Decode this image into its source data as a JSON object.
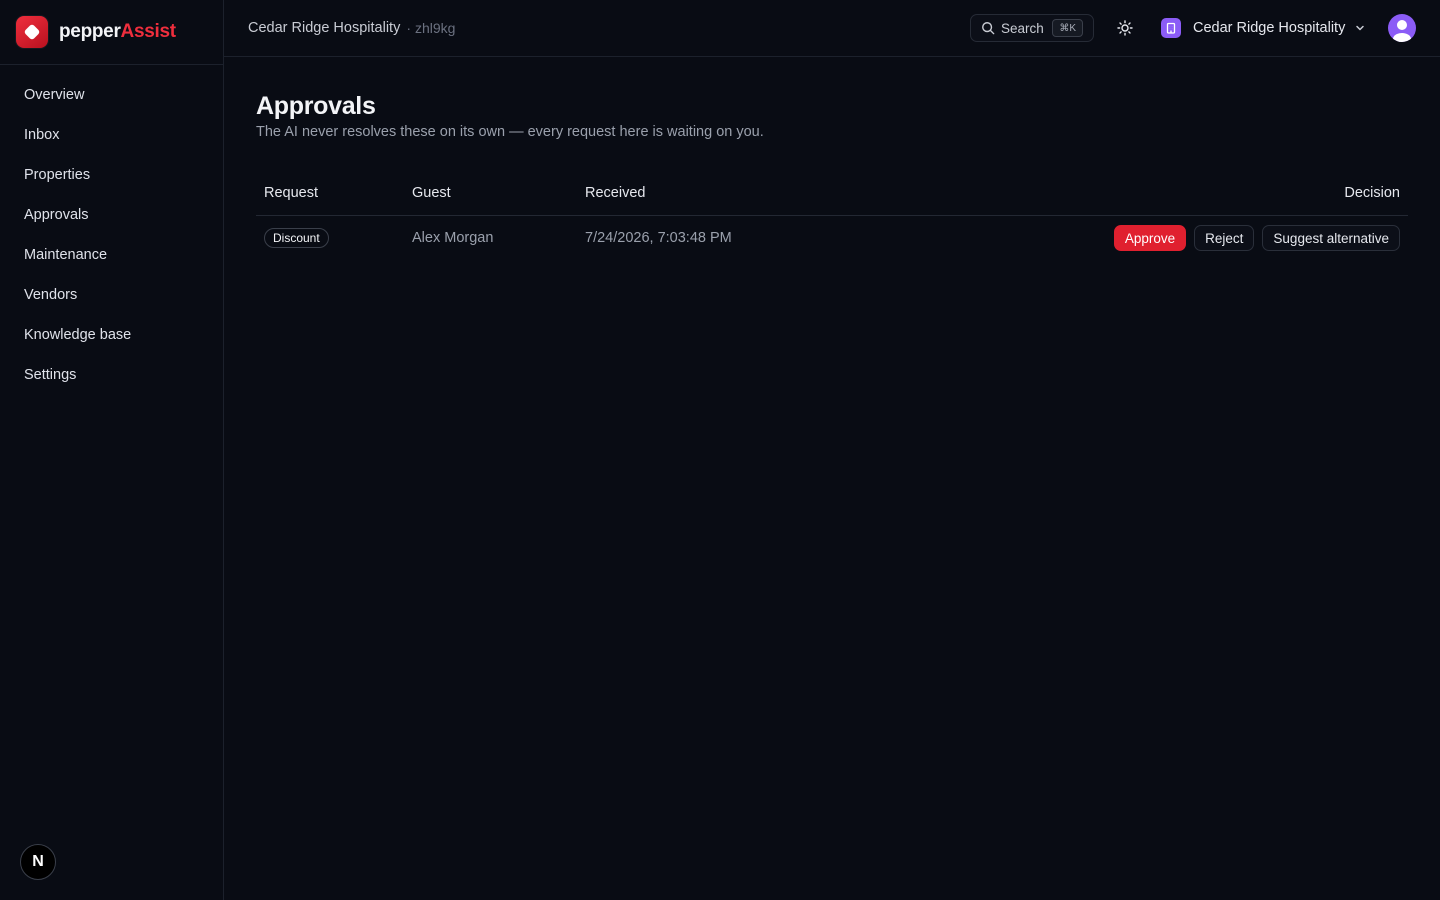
{
  "brand": {
    "name_part1": "pepper",
    "name_part2": "Assist",
    "accent": "#ef2e3d"
  },
  "sidebar": {
    "items": [
      {
        "label": "Overview"
      },
      {
        "label": "Inbox"
      },
      {
        "label": "Properties"
      },
      {
        "label": "Approvals"
      },
      {
        "label": "Maintenance"
      },
      {
        "label": "Vendors"
      },
      {
        "label": "Knowledge base"
      },
      {
        "label": "Settings"
      }
    ],
    "footer_badge": "N"
  },
  "topbar": {
    "breadcrumb_main": "Cedar Ridge Hospitality",
    "breadcrumb_sep": "·",
    "breadcrumb_sub": "zhl9kg",
    "search_label": "Search",
    "search_shortcut": "⌘K",
    "theme_icon": "sun-icon",
    "org_name": "Cedar Ridge Hospitality",
    "org_color": "#8b5cf6"
  },
  "main": {
    "title": "Approvals",
    "subtitle": "The AI never resolves these on its own — every request here is waiting on you.",
    "table": {
      "headers": {
        "request": "Request",
        "guest": "Guest",
        "received": "Received",
        "decision": "Decision"
      },
      "rows": [
        {
          "request": "Discount",
          "guest": "Alex Morgan",
          "received": "7/24/2026, 7:03:48 PM",
          "actions": {
            "approve": "Approve",
            "reject": "Reject",
            "suggest": "Suggest alternative"
          }
        }
      ]
    }
  }
}
